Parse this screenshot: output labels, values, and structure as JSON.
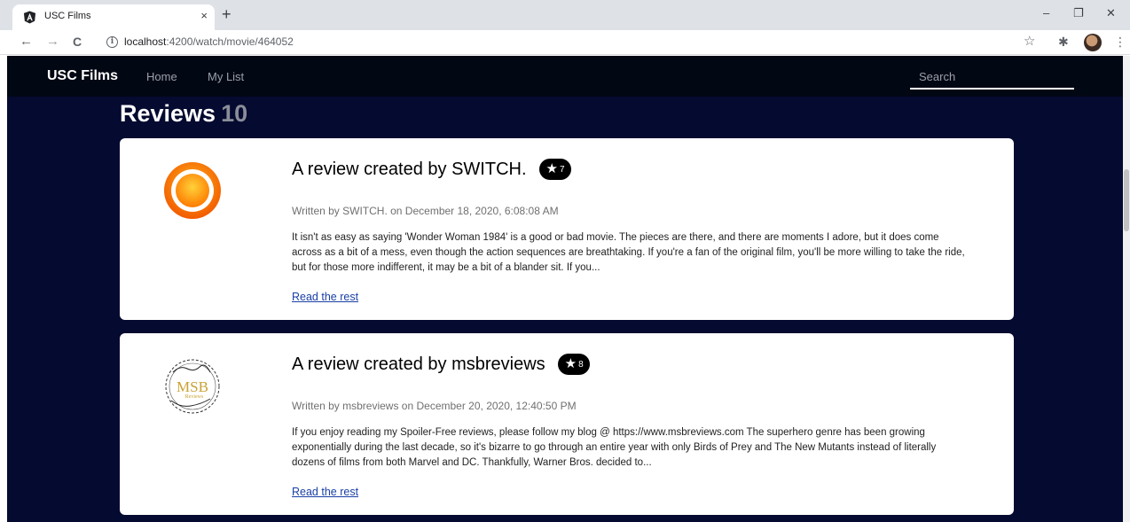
{
  "browser": {
    "tab_title": "USC Films",
    "tab_close": "×",
    "new_tab": "+",
    "url_host": "localhost",
    "url_rest": ":4200/watch/movie/464052",
    "win_min": "–",
    "win_restore": "❐",
    "win_close": "✕",
    "back": "←",
    "forward": "→",
    "reload": "C",
    "info": "i",
    "bookmark": "☆",
    "extensions": "✱",
    "menu": "⋮"
  },
  "navbar": {
    "brand": "USC Films",
    "links": [
      "Home",
      "My List"
    ],
    "search_placeholder": "Search"
  },
  "reviews": {
    "heading": "Reviews",
    "count": "10",
    "items": [
      {
        "title": "A review created by SWITCH.",
        "rating": "7",
        "meta": "Written by SWITCH. on December 18, 2020, 6:08:08 AM",
        "body": "It isn't as easy as saying 'Wonder Woman 1984' is a good or bad movie. The pieces are there, and there are moments I adore, but it does come across as a bit of a mess, even though the action sequences are breathtaking. If you're a fan of the original film, you'll be more willing to take the ride, but for those more indifferent, it may be a bit of a blander sit. If you...",
        "link": "Read the rest",
        "avatar_icon": "orange-ring-icon"
      },
      {
        "title": "A review created by msbreviews",
        "rating": "8",
        "meta": "Written by msbreviews on December 20, 2020, 12:40:50 PM",
        "body": "If you enjoy reading my Spoiler-Free reviews, please follow my blog @ https://www.msbreviews.com The superhero genre has been growing exponentially during the last decade, so it's bizarre to go through an entire year with only Birds of Prey and The New Mutants instead of literally dozens of films from both Marvel and DC. Thankfully, Warner Bros. decided to...",
        "link": "Read the rest",
        "avatar_icon": "msb-logo-icon",
        "avatar_text": "MSB",
        "avatar_subtext": "Reviews"
      }
    ]
  },
  "icons": {
    "star": "★"
  },
  "colors": {
    "page_bg": "#050a30",
    "navbar_bg": "#020714",
    "rating_badge": "#000000",
    "link": "#1a3fa6"
  }
}
